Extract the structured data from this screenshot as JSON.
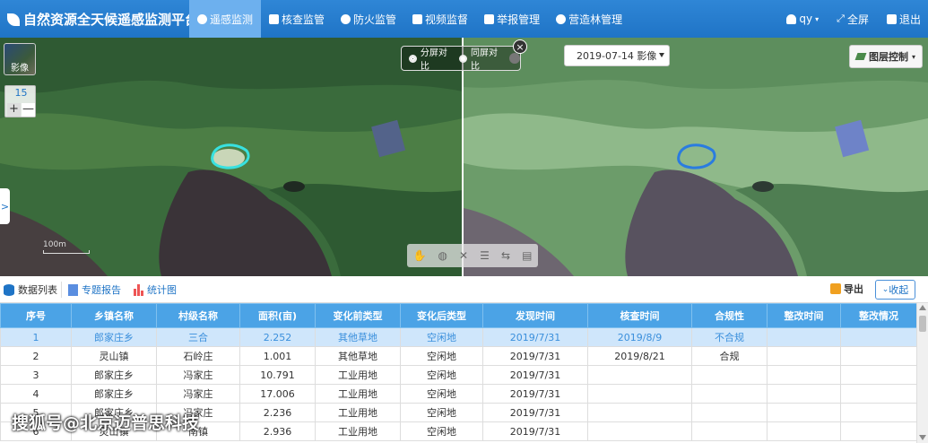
{
  "header": {
    "title": "自然资源全天候遥感监测平台",
    "nav": [
      {
        "label": "遥感监测",
        "icon": "globe-icon",
        "active": true
      },
      {
        "label": "核查监管",
        "icon": "list-icon",
        "active": false
      },
      {
        "label": "防火监管",
        "icon": "fire-icon",
        "active": false
      },
      {
        "label": "视频监督",
        "icon": "video-icon",
        "active": false
      },
      {
        "label": "举报管理",
        "icon": "flag-icon",
        "active": false
      },
      {
        "label": "营造林管理",
        "icon": "tree-icon",
        "active": false
      }
    ],
    "user": "qy",
    "fullscreen": "全屏",
    "logout": "退出",
    "accent_color": "#1f74c6"
  },
  "map": {
    "basemap_label": "影像",
    "zoom_level": "15",
    "zoom_in": "+",
    "zoom_out": "—",
    "scale_label": "100m",
    "compare": {
      "split_label": "分屏对比",
      "same_label": "同屏对比",
      "close": "×"
    },
    "date_value": "2019-07-14 影像",
    "layers_label": "图层控制",
    "side_toggle": ">"
  },
  "panel": {
    "tab_list": "数据列表",
    "tab_report": "专题报告",
    "tab_stats": "统计图",
    "export": "导出",
    "collapse": "收起"
  },
  "table": {
    "columns": [
      "序号",
      "乡镇名称",
      "村级名称",
      "面积(亩)",
      "变化前类型",
      "变化后类型",
      "发现时间",
      "核查时间",
      "合规性",
      "整改时间",
      "整改情况"
    ],
    "rows": [
      [
        "1",
        "郎家庄乡",
        "三合",
        "2.252",
        "其他草地",
        "空闲地",
        "2019/7/31",
        "2019/8/9",
        "不合规",
        "",
        ""
      ],
      [
        "2",
        "灵山镇",
        "石岭庄",
        "1.001",
        "其他草地",
        "空闲地",
        "2019/7/31",
        "2019/8/21",
        "合规",
        "",
        ""
      ],
      [
        "3",
        "郎家庄乡",
        "冯家庄",
        "10.791",
        "工业用地",
        "空闲地",
        "2019/7/31",
        "",
        "",
        "",
        ""
      ],
      [
        "4",
        "郎家庄乡",
        "冯家庄",
        "17.006",
        "工业用地",
        "空闲地",
        "2019/7/31",
        "",
        "",
        "",
        ""
      ],
      [
        "5",
        "郎家庄乡",
        "冯家庄",
        "2.236",
        "工业用地",
        "空闲地",
        "2019/7/31",
        "",
        "",
        "",
        ""
      ],
      [
        "6",
        "灵山镇",
        "南镇",
        "2.936",
        "工业用地",
        "空闲地",
        "2019/7/31",
        "",
        "",
        "",
        ""
      ]
    ]
  },
  "watermark": "搜狐号@北京迈普思科技"
}
